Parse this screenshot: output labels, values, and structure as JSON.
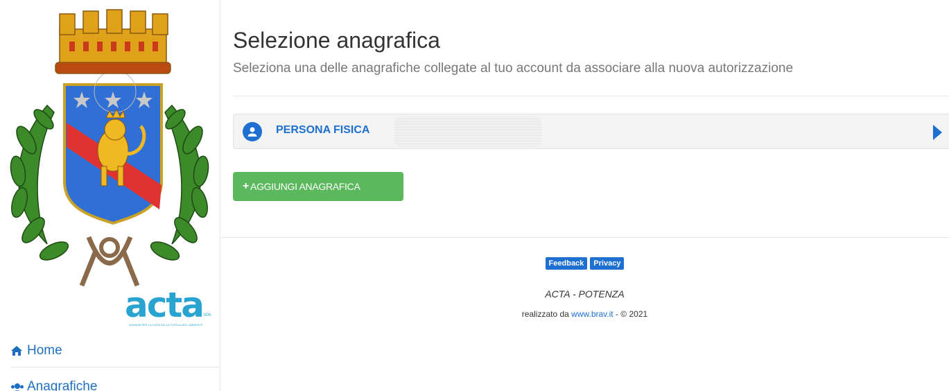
{
  "sidebar": {
    "brand": {
      "name": "acta",
      "suffix": "SPA",
      "tagline": "AGENZIA PER LA CURA DELLA TUTELA DELL'AMBIENTE"
    },
    "nav": [
      {
        "label": "Home",
        "icon": "home-icon"
      },
      {
        "label": "Anagrafiche",
        "icon": "users-icon"
      }
    ]
  },
  "main": {
    "title": "Selezione anagrafica",
    "subtitle": "Seleziona una delle anagrafiche collegate al tuo account da associare alla nuova autorizzazione",
    "entries": [
      {
        "label": "PERSONA FISICA",
        "icon": "user-icon",
        "name_redacted": true
      }
    ],
    "add_button": {
      "icon": "plus-icon",
      "label": "AGGIUNGI ANAGRAFICA"
    }
  },
  "footer": {
    "badges": [
      "Feedback",
      "Privacy"
    ],
    "org": "ACTA - POTENZA",
    "credit_prefix": "realizzato da ",
    "credit_link": "www.brav.it",
    "credit_suffix": " - © 2021"
  },
  "colors": {
    "primary": "#1d6fd0",
    "success": "#5cb85c",
    "brand": "#29a3cf",
    "panel_bg": "#f3f3f3"
  }
}
